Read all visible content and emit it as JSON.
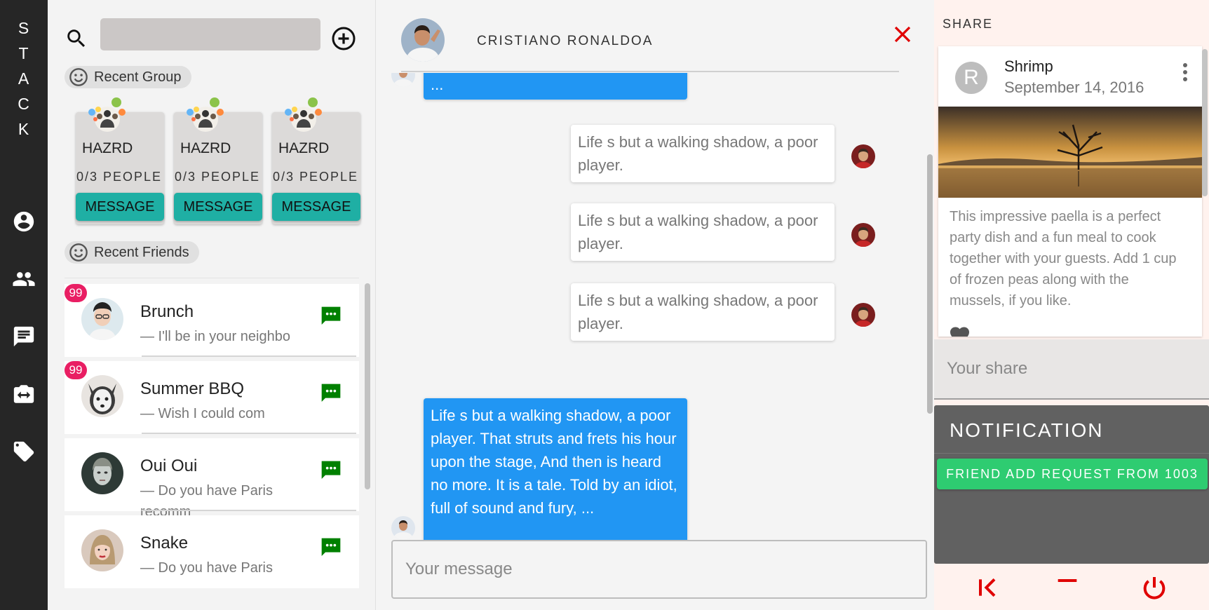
{
  "brand": {
    "letters": [
      "S",
      "T",
      "A",
      "C",
      "K"
    ]
  },
  "nav": {
    "items": [
      {
        "name": "account",
        "icon": "account-circle-icon"
      },
      {
        "name": "friends",
        "icon": "people-icon"
      },
      {
        "name": "messages",
        "icon": "chat-icon"
      },
      {
        "name": "camera",
        "icon": "camera-switch-icon"
      },
      {
        "name": "tags",
        "icon": "tag-icon"
      }
    ]
  },
  "search": {
    "value": "",
    "placeholder": ""
  },
  "recent_group": {
    "label": "Recent Group",
    "groups": [
      {
        "name": "HAZRD",
        "count": "0/3 PEOPLE",
        "button": "MESSAGE"
      },
      {
        "name": "HAZRD",
        "count": "0/3 PEOPLE",
        "button": "MESSAGE"
      },
      {
        "name": "HAZRD",
        "count": "0/3 PEOPLE",
        "button": "MESSAGE"
      }
    ]
  },
  "recent_friends": {
    "label": "Recent Friends",
    "items": [
      {
        "name": "Brunch",
        "message": "— I'll be in your neighbo",
        "badge": "99"
      },
      {
        "name": "Summer BBQ",
        "message": "— Wish I could com",
        "badge": "99"
      },
      {
        "name": "Oui Oui",
        "message": "— Do you have Paris recomm",
        "badge": ""
      },
      {
        "name": "Snake",
        "message": "— Do you have Paris",
        "badge": ""
      }
    ]
  },
  "chat": {
    "title": "CRISTIANO RONALDOA",
    "messages": [
      {
        "direction": "out",
        "text": "..."
      },
      {
        "direction": "in",
        "text": "Life s but a walking shadow, a poor player."
      },
      {
        "direction": "in",
        "text": "Life s but a walking shadow, a poor player."
      },
      {
        "direction": "in",
        "text": "Life s but a walking shadow, a poor player."
      },
      {
        "direction": "out",
        "text": "Life s but a walking shadow, a poor player. That struts and frets his hour upon the stage, And then is heard no more. It is a tale. Told by an idiot, full of sound and fury, ..."
      }
    ],
    "input_placeholder": "Your message"
  },
  "share": {
    "heading": "SHARE",
    "post": {
      "avatar_letter": "R",
      "author": "Shrimp",
      "date": "September 14, 2016",
      "body": "This impressive paella is a perfect party dish and a fun meal to cook together with your guests. Add 1 cup of frozen peas along with the mussels, if you like."
    },
    "input_placeholder": "Your share"
  },
  "notification": {
    "title": "NOTIFICATION",
    "request": "FRIEND ADD REQUEST FROM 1003"
  },
  "footer": {
    "icons": [
      "first-page-icon",
      "minimize-icon",
      "power-icon"
    ]
  },
  "colors": {
    "rail": "#262626",
    "teal": "#1fafa4",
    "blue_bubble": "#2196f3",
    "badge": "#e91e63",
    "chat_green": "#008000",
    "close_red": "#e00000",
    "notif_green": "#2ecc71",
    "notif_bg": "#616161"
  }
}
